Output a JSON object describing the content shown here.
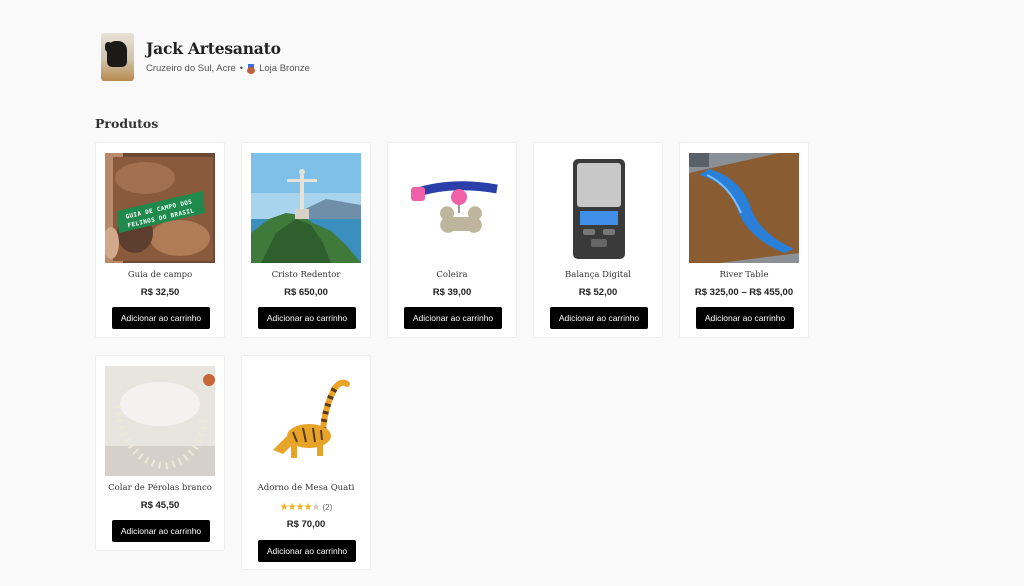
{
  "store": {
    "name": "Jack Artesanato",
    "location": "Cruzeiro do Sul, Acre",
    "separator": "•",
    "tier": "Loja Bronze"
  },
  "section": {
    "title": "Produtos"
  },
  "products": [
    {
      "name": "Guia de campo",
      "price": "R$ 32,50",
      "button": "Adicionar ao carrinho",
      "cover_text": "GUIA DE CAMPO DOS FELINOS DO BRASIL"
    },
    {
      "name": "Cristo Redentor",
      "price": "R$ 650,00",
      "button": "Adicionar ao carrinho"
    },
    {
      "name": "Coleira",
      "price": "R$ 39,00",
      "button": "Adicionar ao carrinho"
    },
    {
      "name": "Balança Digital",
      "price": "R$ 52,00",
      "button": "Adicionar ao carrinho"
    },
    {
      "name": "River Table",
      "price": "R$ 325,00 – R$ 455,00",
      "button": "Adicionar ao carrinho"
    },
    {
      "name": "Colar de Pérolas branco",
      "price": "R$ 45,50",
      "button": "Adicionar ao carrinho"
    },
    {
      "name": "Adorno de Mesa Quati",
      "price": "R$ 70,00",
      "button": "Adicionar ao carrinho",
      "rating": {
        "value": 4,
        "max": 5,
        "count": "(2)"
      }
    }
  ],
  "colors": {
    "button_bg": "#000000",
    "star": "#f2b01e",
    "page_bg": "#f9f9f9"
  }
}
